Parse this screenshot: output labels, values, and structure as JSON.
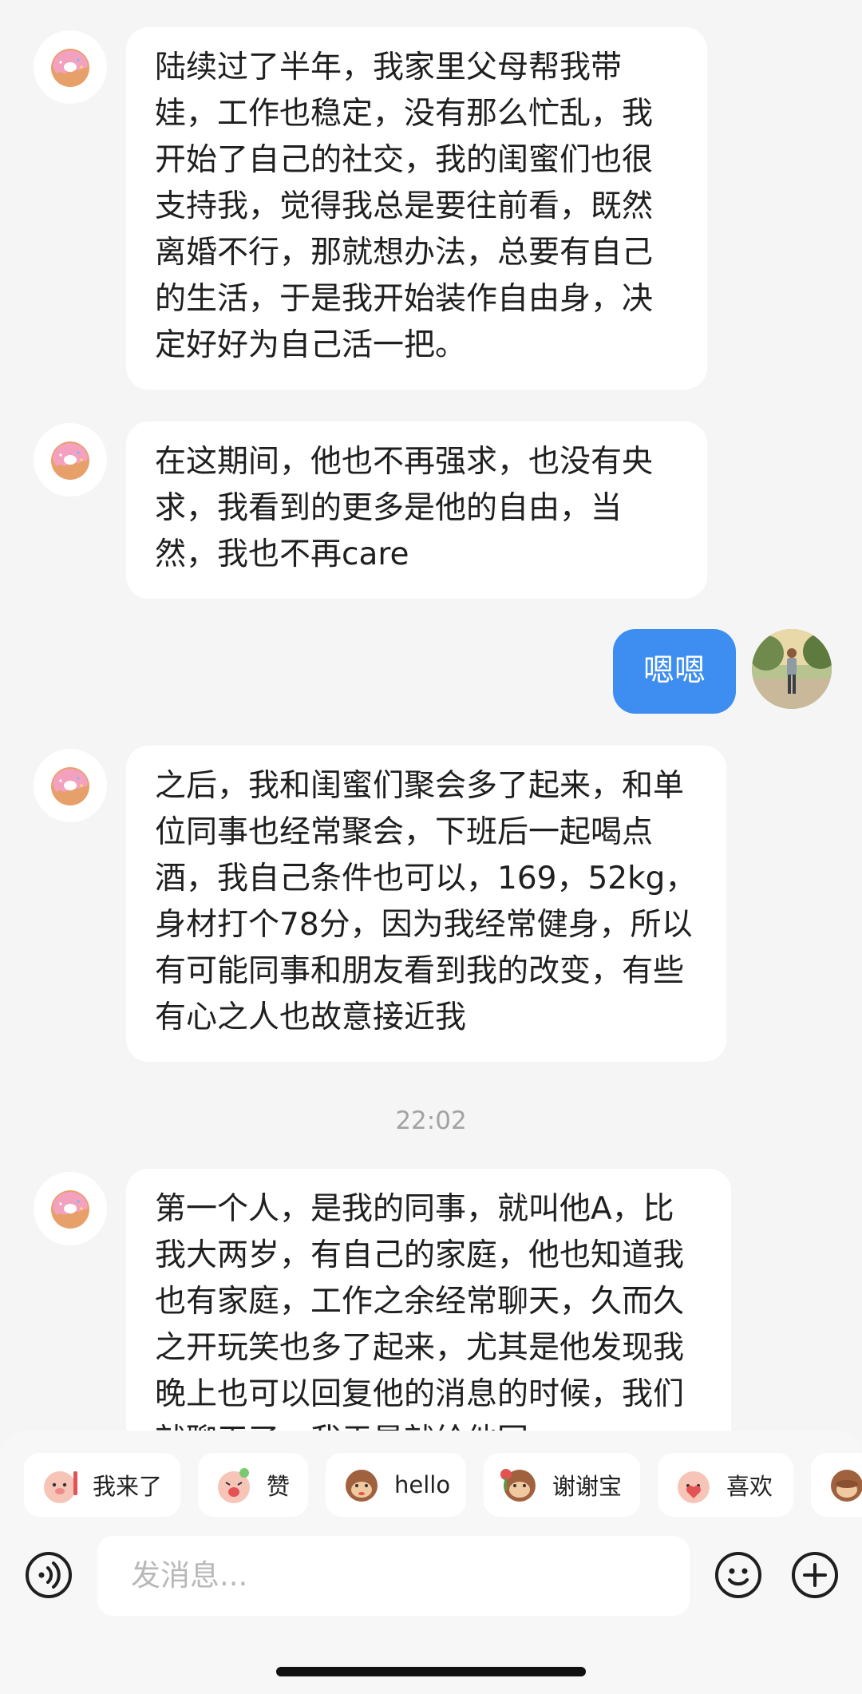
{
  "messages": [
    {
      "text": "陆续过了半年，我家里父母帮我带娃，工作也稳定，没有那么忙乱，我开始了自己的社交，我的闺蜜们也很支持我，觉得我总是要往前看，既然离婚不行，那就想办法，总要有自己的生活，于是我开始装作自由身，决定好好为自己活一把。"
    },
    {
      "text": "在这期间，他也不再强求，也没有央求，我看到的更多是他的自由，当然，我也不再care"
    },
    {
      "text": "嗯嗯"
    },
    {
      "text": "之后，我和闺蜜们聚会多了起来，和单位同事也经常聚会，下班后一起喝点酒，我自己条件也可以，169，52kg，身材打个78分，因为我经常健身，所以有可能同事和朋友看到我的改变，有些有心之人也故意接近我"
    },
    {
      "timestamp": "22:02"
    },
    {
      "text": "第一个人，是我的同事，就叫他A，比我大两岁，有自己的家庭，他也知道我也有家庭，工作之余经常聊天，久而久之开玩笑也多了起来，尤其是他发现我晚上也可以回复他的消息的时候，我们就聊天了，我于是就给他回"
    }
  ],
  "stickers": [
    {
      "label": "我来了",
      "icon": "sticker-pig-wave-icon"
    },
    {
      "label": "赞",
      "icon": "sticker-pig-cheer-icon"
    },
    {
      "label": "hello",
      "icon": "sticker-monkey-hello-icon"
    },
    {
      "label": "谢谢宝",
      "icon": "sticker-monkey-flower-icon"
    },
    {
      "label": "喜欢",
      "icon": "sticker-pig-love-icon"
    }
  ],
  "input": {
    "placeholder": "发消息..."
  },
  "colors": {
    "self_bubble": "#3d8ef0",
    "background": "#f5f5f5",
    "bubble": "#ffffff"
  }
}
